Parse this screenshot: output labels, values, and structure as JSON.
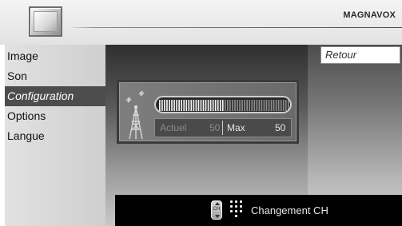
{
  "header": {
    "brand": "MAGNAVOX",
    "icon": "tv-icon"
  },
  "menu": {
    "items": [
      {
        "label": "Image",
        "active": false
      },
      {
        "label": "Son",
        "active": false
      },
      {
        "label": "Configuration",
        "active": true
      },
      {
        "label": "Options",
        "active": false
      },
      {
        "label": "Langue",
        "active": false
      }
    ]
  },
  "right_panel": {
    "retour_label": "Retour"
  },
  "signal": {
    "icon": "antenna-icon",
    "level_fraction": 0.5,
    "current_label": "Actuel",
    "current_value": "50",
    "max_label": "Max",
    "max_value": "50"
  },
  "bottom_bar": {
    "ch_icon": "ch-button-icon",
    "keypad_icon": "keypad-icon",
    "label": "Changement CH"
  }
}
